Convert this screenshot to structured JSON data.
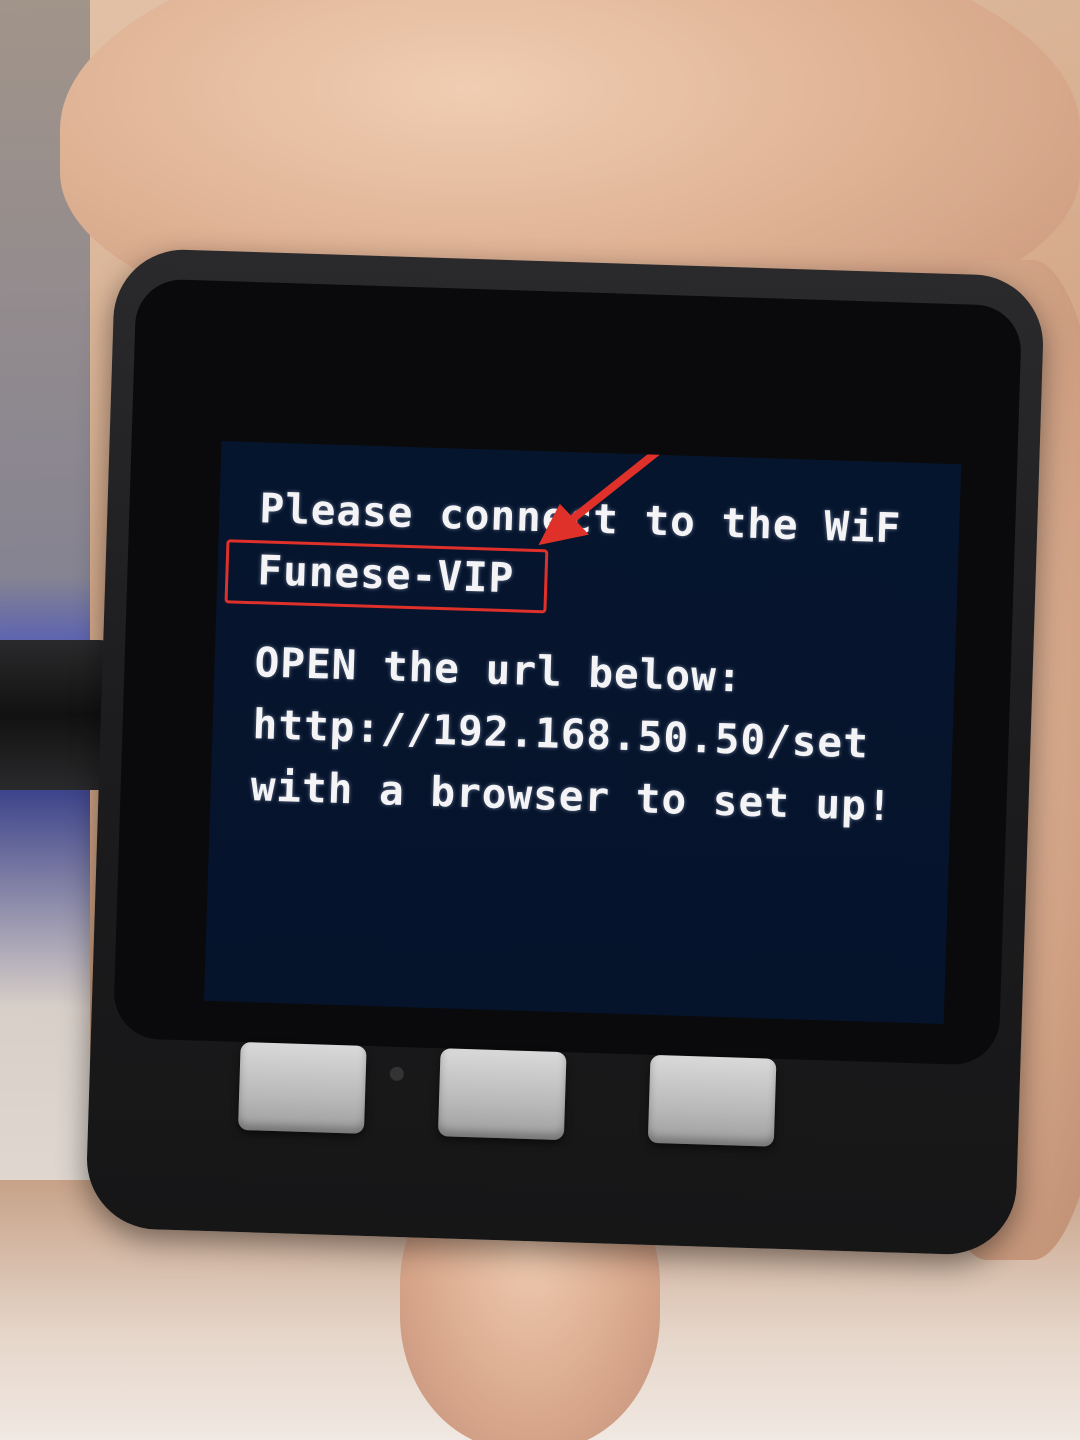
{
  "screen": {
    "lines": [
      "Please connect to the WiF",
      "Funese-VIP",
      "OPEN the url below:",
      "http://192.168.50.50/set",
      "with a browser to set up!"
    ]
  },
  "colors": {
    "screen_background": "#06152e",
    "screen_text": "#f4f4f6",
    "annotation": "#e0302a",
    "device_body": "#1c1c1e",
    "button": "#c4c4c4"
  },
  "annotations": {
    "highlight_target": "wifi-ssid",
    "arrow_icon": "arrow-icon"
  }
}
